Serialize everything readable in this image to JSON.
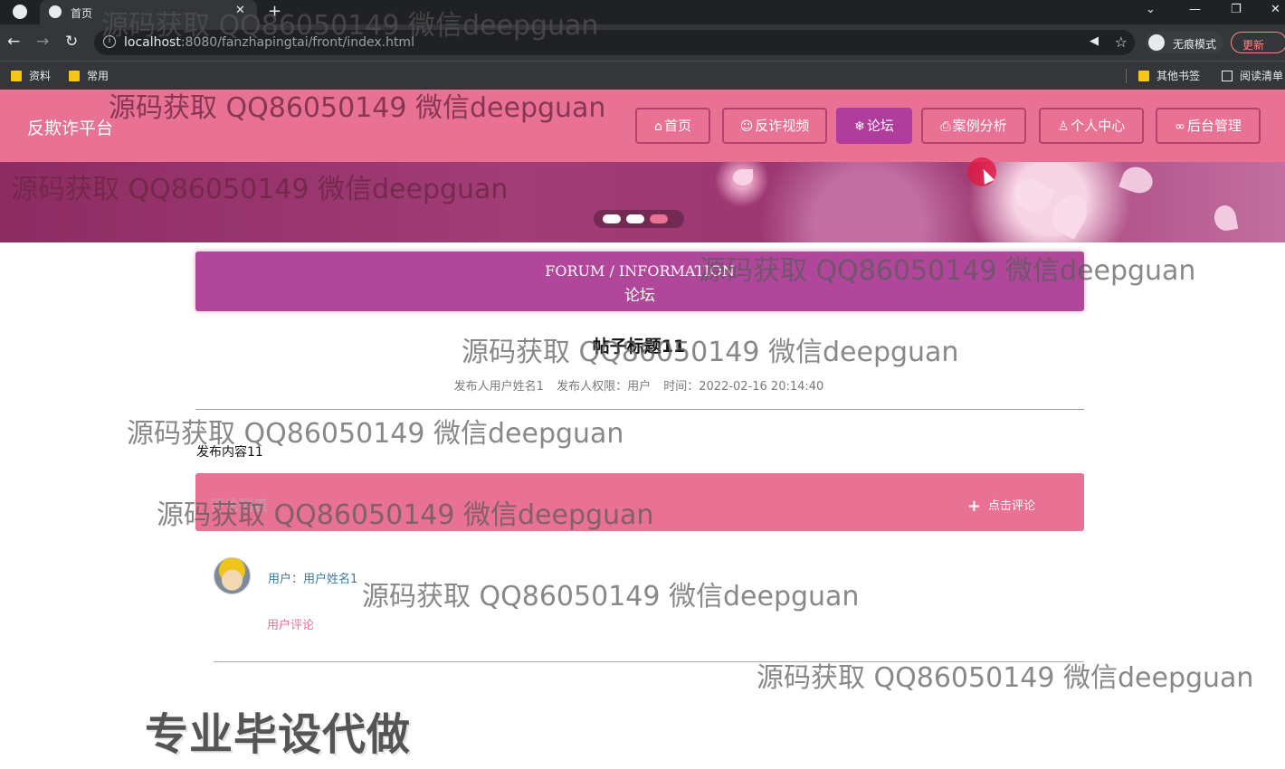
{
  "browser": {
    "tab_title": "首页",
    "url_host": "localhost",
    "url_path": ":8080/fanzhapingtai/front/index.html",
    "incognito_label": "无痕模式",
    "update_label": "更新",
    "bookmarks": [
      "资料",
      "常用"
    ],
    "bookmarks_right": [
      "其他书签",
      "阅读清单"
    ]
  },
  "site": {
    "brand": "反欺诈平台",
    "nav": [
      {
        "label": "首页",
        "icon": "home-icon"
      },
      {
        "label": "反诈视频",
        "icon": "smile-icon"
      },
      {
        "label": "论坛",
        "icon": "snowflake-icon",
        "active": true
      },
      {
        "label": "案例分析",
        "icon": "print-icon"
      },
      {
        "label": "个人中心",
        "icon": "user-icon"
      },
      {
        "label": "后台管理",
        "icon": "link-icon"
      }
    ],
    "accent": "#e87194",
    "active_color": "#b03d9c",
    "carousel_active_index": 2
  },
  "section": {
    "title_en": "FORUM / INFORMATION",
    "title_cn": "论坛"
  },
  "post": {
    "title": "帖子标题11",
    "author": "发布人用户姓名1",
    "role": "发布人权限：用户",
    "time": "时间：2022-02-16 20:14:40",
    "content": "发布内容11"
  },
  "comments": {
    "header_label": "评论列表",
    "add_label": "点击评论",
    "items": [
      {
        "user": "用户：用户姓名1",
        "text": "用户评论"
      }
    ]
  },
  "watermark": "源码获取 QQ86050149 微信deepguan",
  "promo": "专业毕设代做"
}
